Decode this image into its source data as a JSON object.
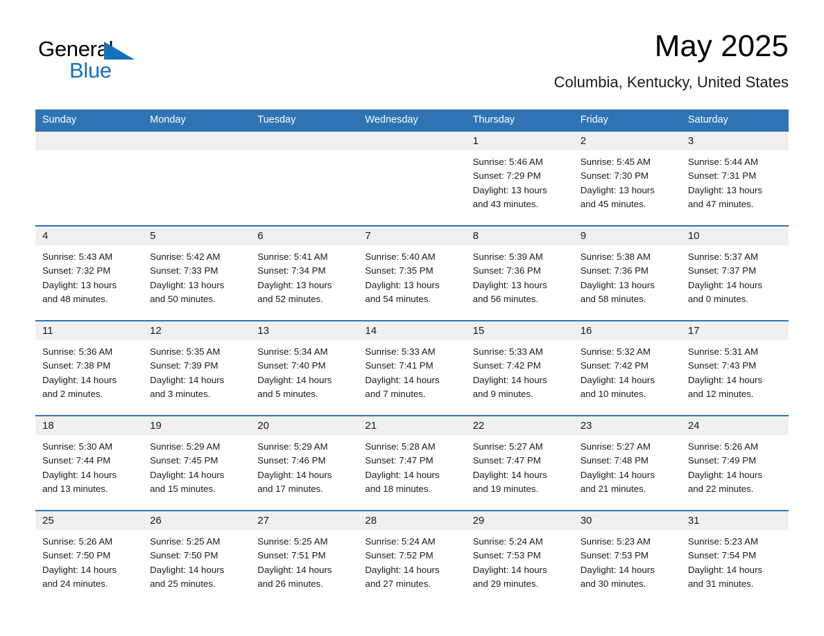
{
  "brand": {
    "name_part1": "General",
    "name_part2": "Blue",
    "accent_color": "#1471bd"
  },
  "header": {
    "month_title": "May 2025",
    "location": "Columbia, Kentucky, United States"
  },
  "theme": {
    "header_blue": "#2e74b5",
    "day_band_gray": "#f0f0f0",
    "text": "#1a1a1a"
  },
  "weekday_headers": [
    "Sunday",
    "Monday",
    "Tuesday",
    "Wednesday",
    "Thursday",
    "Friday",
    "Saturday"
  ],
  "weeks": [
    {
      "days": [
        {
          "number": "",
          "sunrise": "",
          "sunset": "",
          "daylight_line1": "",
          "daylight_line2": ""
        },
        {
          "number": "",
          "sunrise": "",
          "sunset": "",
          "daylight_line1": "",
          "daylight_line2": ""
        },
        {
          "number": "",
          "sunrise": "",
          "sunset": "",
          "daylight_line1": "",
          "daylight_line2": ""
        },
        {
          "number": "",
          "sunrise": "",
          "sunset": "",
          "daylight_line1": "",
          "daylight_line2": ""
        },
        {
          "number": "1",
          "sunrise": "Sunrise: 5:46 AM",
          "sunset": "Sunset: 7:29 PM",
          "daylight_line1": "Daylight: 13 hours",
          "daylight_line2": "and 43 minutes."
        },
        {
          "number": "2",
          "sunrise": "Sunrise: 5:45 AM",
          "sunset": "Sunset: 7:30 PM",
          "daylight_line1": "Daylight: 13 hours",
          "daylight_line2": "and 45 minutes."
        },
        {
          "number": "3",
          "sunrise": "Sunrise: 5:44 AM",
          "sunset": "Sunset: 7:31 PM",
          "daylight_line1": "Daylight: 13 hours",
          "daylight_line2": "and 47 minutes."
        }
      ]
    },
    {
      "days": [
        {
          "number": "4",
          "sunrise": "Sunrise: 5:43 AM",
          "sunset": "Sunset: 7:32 PM",
          "daylight_line1": "Daylight: 13 hours",
          "daylight_line2": "and 48 minutes."
        },
        {
          "number": "5",
          "sunrise": "Sunrise: 5:42 AM",
          "sunset": "Sunset: 7:33 PM",
          "daylight_line1": "Daylight: 13 hours",
          "daylight_line2": "and 50 minutes."
        },
        {
          "number": "6",
          "sunrise": "Sunrise: 5:41 AM",
          "sunset": "Sunset: 7:34 PM",
          "daylight_line1": "Daylight: 13 hours",
          "daylight_line2": "and 52 minutes."
        },
        {
          "number": "7",
          "sunrise": "Sunrise: 5:40 AM",
          "sunset": "Sunset: 7:35 PM",
          "daylight_line1": "Daylight: 13 hours",
          "daylight_line2": "and 54 minutes."
        },
        {
          "number": "8",
          "sunrise": "Sunrise: 5:39 AM",
          "sunset": "Sunset: 7:36 PM",
          "daylight_line1": "Daylight: 13 hours",
          "daylight_line2": "and 56 minutes."
        },
        {
          "number": "9",
          "sunrise": "Sunrise: 5:38 AM",
          "sunset": "Sunset: 7:36 PM",
          "daylight_line1": "Daylight: 13 hours",
          "daylight_line2": "and 58 minutes."
        },
        {
          "number": "10",
          "sunrise": "Sunrise: 5:37 AM",
          "sunset": "Sunset: 7:37 PM",
          "daylight_line1": "Daylight: 14 hours",
          "daylight_line2": "and 0 minutes."
        }
      ]
    },
    {
      "days": [
        {
          "number": "11",
          "sunrise": "Sunrise: 5:36 AM",
          "sunset": "Sunset: 7:38 PM",
          "daylight_line1": "Daylight: 14 hours",
          "daylight_line2": "and 2 minutes."
        },
        {
          "number": "12",
          "sunrise": "Sunrise: 5:35 AM",
          "sunset": "Sunset: 7:39 PM",
          "daylight_line1": "Daylight: 14 hours",
          "daylight_line2": "and 3 minutes."
        },
        {
          "number": "13",
          "sunrise": "Sunrise: 5:34 AM",
          "sunset": "Sunset: 7:40 PM",
          "daylight_line1": "Daylight: 14 hours",
          "daylight_line2": "and 5 minutes."
        },
        {
          "number": "14",
          "sunrise": "Sunrise: 5:33 AM",
          "sunset": "Sunset: 7:41 PM",
          "daylight_line1": "Daylight: 14 hours",
          "daylight_line2": "and 7 minutes."
        },
        {
          "number": "15",
          "sunrise": "Sunrise: 5:33 AM",
          "sunset": "Sunset: 7:42 PM",
          "daylight_line1": "Daylight: 14 hours",
          "daylight_line2": "and 9 minutes."
        },
        {
          "number": "16",
          "sunrise": "Sunrise: 5:32 AM",
          "sunset": "Sunset: 7:42 PM",
          "daylight_line1": "Daylight: 14 hours",
          "daylight_line2": "and 10 minutes."
        },
        {
          "number": "17",
          "sunrise": "Sunrise: 5:31 AM",
          "sunset": "Sunset: 7:43 PM",
          "daylight_line1": "Daylight: 14 hours",
          "daylight_line2": "and 12 minutes."
        }
      ]
    },
    {
      "days": [
        {
          "number": "18",
          "sunrise": "Sunrise: 5:30 AM",
          "sunset": "Sunset: 7:44 PM",
          "daylight_line1": "Daylight: 14 hours",
          "daylight_line2": "and 13 minutes."
        },
        {
          "number": "19",
          "sunrise": "Sunrise: 5:29 AM",
          "sunset": "Sunset: 7:45 PM",
          "daylight_line1": "Daylight: 14 hours",
          "daylight_line2": "and 15 minutes."
        },
        {
          "number": "20",
          "sunrise": "Sunrise: 5:29 AM",
          "sunset": "Sunset: 7:46 PM",
          "daylight_line1": "Daylight: 14 hours",
          "daylight_line2": "and 17 minutes."
        },
        {
          "number": "21",
          "sunrise": "Sunrise: 5:28 AM",
          "sunset": "Sunset: 7:47 PM",
          "daylight_line1": "Daylight: 14 hours",
          "daylight_line2": "and 18 minutes."
        },
        {
          "number": "22",
          "sunrise": "Sunrise: 5:27 AM",
          "sunset": "Sunset: 7:47 PM",
          "daylight_line1": "Daylight: 14 hours",
          "daylight_line2": "and 19 minutes."
        },
        {
          "number": "23",
          "sunrise": "Sunrise: 5:27 AM",
          "sunset": "Sunset: 7:48 PM",
          "daylight_line1": "Daylight: 14 hours",
          "daylight_line2": "and 21 minutes."
        },
        {
          "number": "24",
          "sunrise": "Sunrise: 5:26 AM",
          "sunset": "Sunset: 7:49 PM",
          "daylight_line1": "Daylight: 14 hours",
          "daylight_line2": "and 22 minutes."
        }
      ]
    },
    {
      "days": [
        {
          "number": "25",
          "sunrise": "Sunrise: 5:26 AM",
          "sunset": "Sunset: 7:50 PM",
          "daylight_line1": "Daylight: 14 hours",
          "daylight_line2": "and 24 minutes."
        },
        {
          "number": "26",
          "sunrise": "Sunrise: 5:25 AM",
          "sunset": "Sunset: 7:50 PM",
          "daylight_line1": "Daylight: 14 hours",
          "daylight_line2": "and 25 minutes."
        },
        {
          "number": "27",
          "sunrise": "Sunrise: 5:25 AM",
          "sunset": "Sunset: 7:51 PM",
          "daylight_line1": "Daylight: 14 hours",
          "daylight_line2": "and 26 minutes."
        },
        {
          "number": "28",
          "sunrise": "Sunrise: 5:24 AM",
          "sunset": "Sunset: 7:52 PM",
          "daylight_line1": "Daylight: 14 hours",
          "daylight_line2": "and 27 minutes."
        },
        {
          "number": "29",
          "sunrise": "Sunrise: 5:24 AM",
          "sunset": "Sunset: 7:53 PM",
          "daylight_line1": "Daylight: 14 hours",
          "daylight_line2": "and 29 minutes."
        },
        {
          "number": "30",
          "sunrise": "Sunrise: 5:23 AM",
          "sunset": "Sunset: 7:53 PM",
          "daylight_line1": "Daylight: 14 hours",
          "daylight_line2": "and 30 minutes."
        },
        {
          "number": "31",
          "sunrise": "Sunrise: 5:23 AM",
          "sunset": "Sunset: 7:54 PM",
          "daylight_line1": "Daylight: 14 hours",
          "daylight_line2": "and 31 minutes."
        }
      ]
    }
  ]
}
